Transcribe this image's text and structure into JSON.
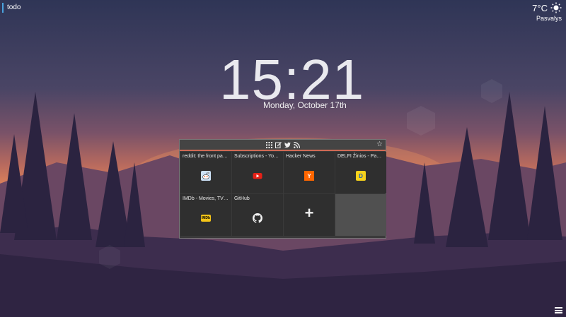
{
  "todo": {
    "label": "todo"
  },
  "weather": {
    "temperature": "7°C",
    "city": "Pasvalys",
    "icon": "sun-icon"
  },
  "clock": {
    "time": "15:21",
    "date": "Monday, October 17th"
  },
  "speed_dial": {
    "toolbar_icons": [
      "apps-grid-icon",
      "notes-icon",
      "twitter-icon",
      "rss-icon"
    ],
    "star_icon": "star-icon",
    "tiles": [
      {
        "title": "reddit: the front pa…",
        "icon": "reddit-icon"
      },
      {
        "title": "Subscriptions - Yo…",
        "icon": "youtube-icon"
      },
      {
        "title": "Hacker News",
        "icon": "hackernews-icon",
        "glyph": "Y"
      },
      {
        "title": "DELFI Žinios - Pa…",
        "icon": "delfi-icon",
        "glyph": "D"
      },
      {
        "title": "IMDb - Movies, TV…",
        "icon": "imdb-icon",
        "glyph": "IMDb"
      },
      {
        "title": "GitHub",
        "icon": "github-icon"
      },
      {
        "title": "",
        "icon": "add-icon",
        "glyph": "+"
      }
    ]
  },
  "colors": {
    "accent": "#d06a55",
    "todo_bar": "#4aa3df"
  }
}
